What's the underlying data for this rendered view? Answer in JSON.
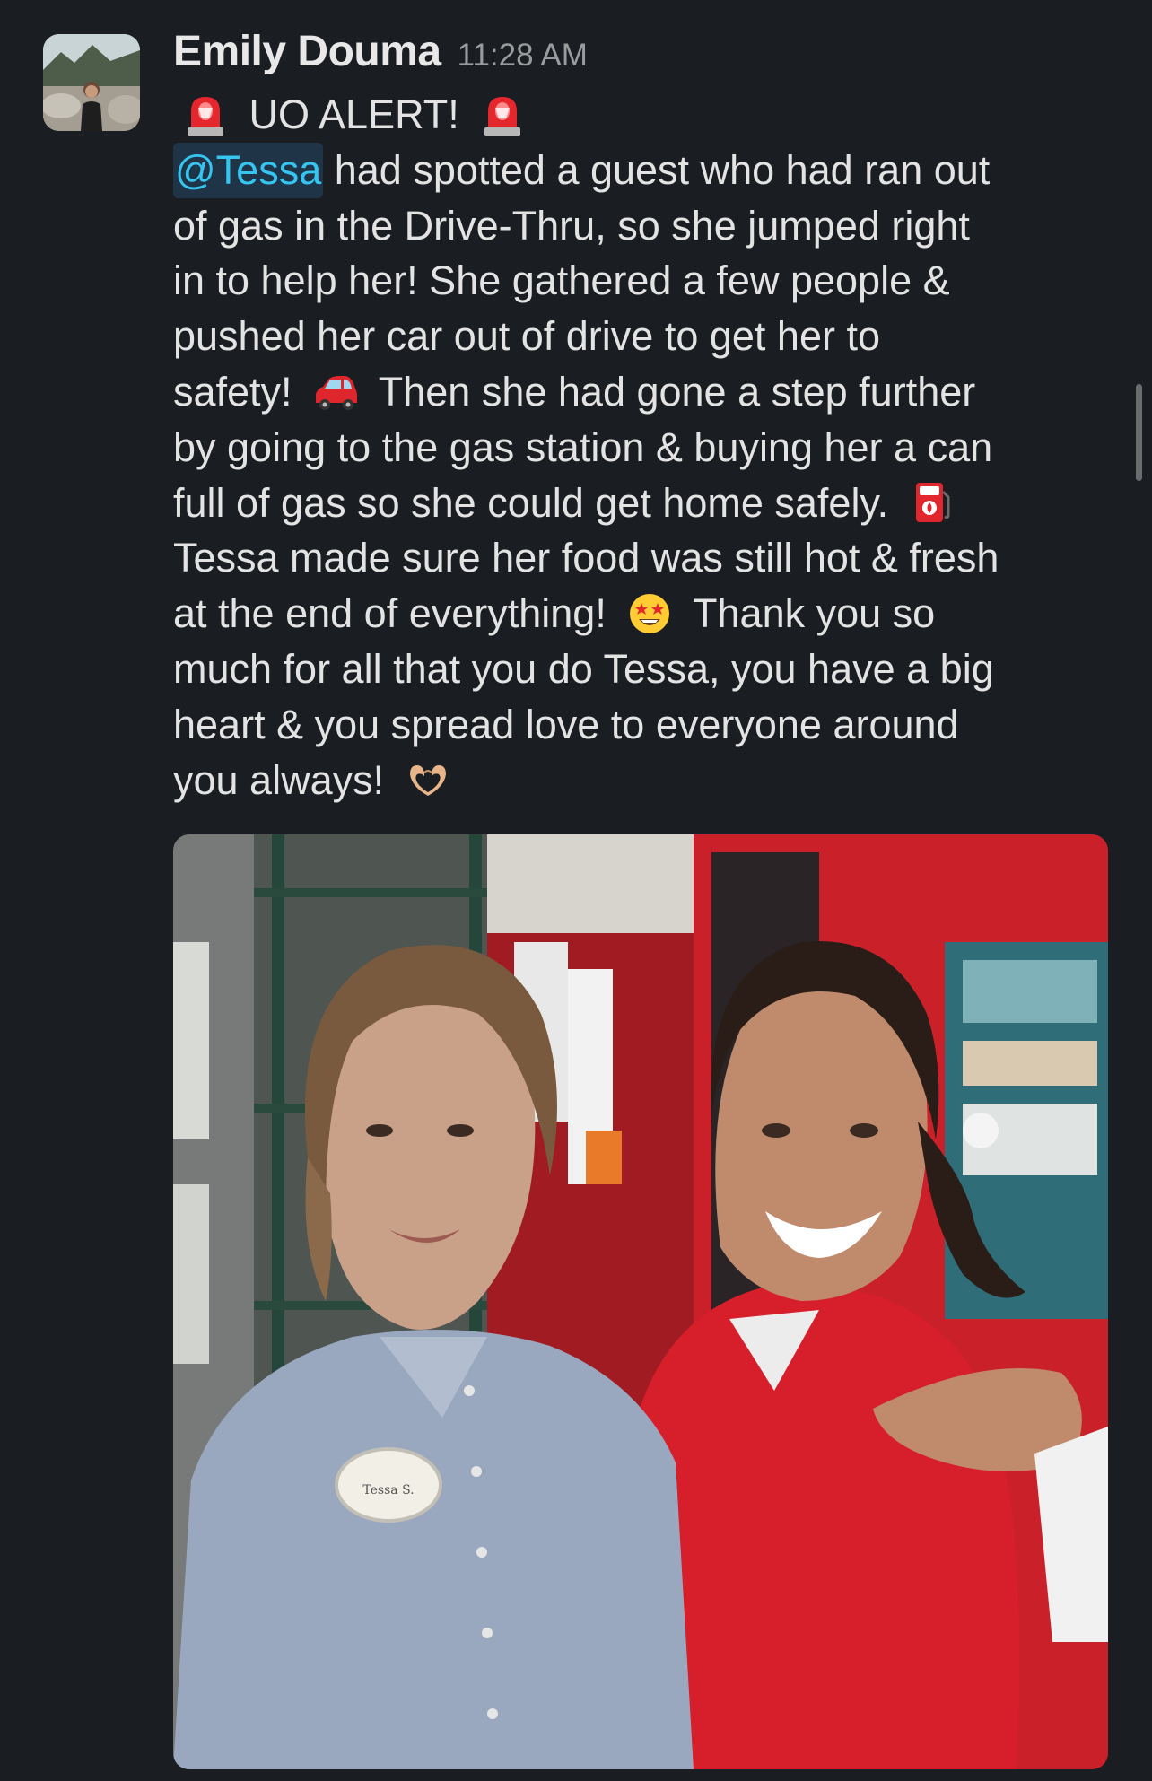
{
  "message": {
    "author": "Emily Douma",
    "timestamp": "11:28 AM",
    "avatar_icon": "user-avatar",
    "lines": [
      [
        {
          "type": "emoji",
          "icon": "rotating-light-icon"
        },
        {
          "type": "text",
          "text": " UO ALERT! "
        },
        {
          "type": "emoji",
          "icon": "rotating-light-icon"
        }
      ],
      [
        {
          "type": "mention",
          "text": "@Tessa"
        },
        {
          "type": "text",
          "text": " had spotted a guest who had ran out"
        }
      ],
      [
        {
          "type": "text",
          "text": "of gas in the Drive-Thru, so she jumped right"
        }
      ],
      [
        {
          "type": "text",
          "text": "in to help her! She gathered a few people &"
        }
      ],
      [
        {
          "type": "text",
          "text": "pushed her car out of drive to get her to"
        }
      ],
      [
        {
          "type": "text",
          "text": "safety! "
        },
        {
          "type": "emoji",
          "icon": "red-car-icon"
        },
        {
          "type": "text",
          "text": " Then she had gone a step further"
        }
      ],
      [
        {
          "type": "text",
          "text": "by going to the gas station & buying her a can"
        }
      ],
      [
        {
          "type": "text",
          "text": "full of gas so she could get home safely. "
        },
        {
          "type": "emoji",
          "icon": "fuel-pump-icon"
        }
      ],
      [
        {
          "type": "text",
          "text": "Tessa made sure her food was still hot & fresh"
        }
      ],
      [
        {
          "type": "text",
          "text": "at the end of everything! "
        },
        {
          "type": "emoji",
          "icon": "star-struck-icon"
        },
        {
          "type": "text",
          "text": " Thank you so"
        }
      ],
      [
        {
          "type": "text",
          "text": "much for all that you do Tessa, you have a big"
        }
      ],
      [
        {
          "type": "text",
          "text": "heart & you spread love to everyone around"
        }
      ],
      [
        {
          "type": "text",
          "text": "you always! "
        },
        {
          "type": "emoji",
          "icon": "heart-hands-icon"
        }
      ]
    ],
    "attachment": {
      "type": "photo",
      "badge_text": "Tessa S."
    }
  },
  "colors": {
    "background": "#1a1d21",
    "text": "#e3e3e3",
    "timestamp": "#9a9b9d",
    "mention_text": "#36c5f0",
    "mention_bg": "#1f3447"
  }
}
